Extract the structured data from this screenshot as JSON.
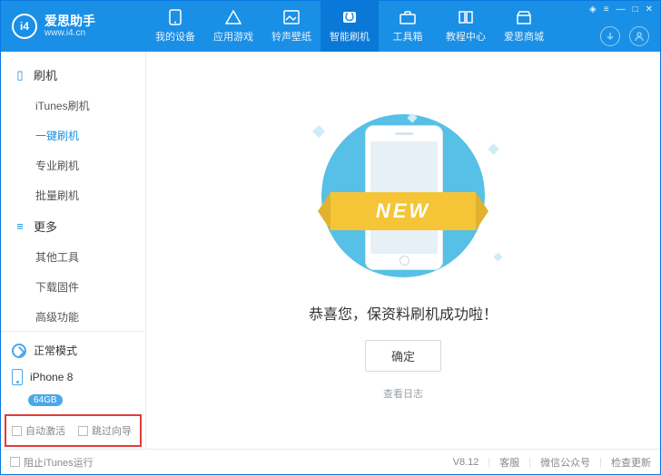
{
  "app": {
    "name": "爱思助手",
    "site": "www.i4.cn",
    "logo_text": "i4"
  },
  "header": {
    "tabs": [
      {
        "id": "device",
        "label": "我的设备"
      },
      {
        "id": "apps",
        "label": "应用游戏"
      },
      {
        "id": "ring",
        "label": "铃声壁纸"
      },
      {
        "id": "flash",
        "label": "智能刷机",
        "active": true
      },
      {
        "id": "tools",
        "label": "工具箱"
      },
      {
        "id": "tutorial",
        "label": "教程中心"
      },
      {
        "id": "store",
        "label": "爱思商城"
      }
    ]
  },
  "sidebar": {
    "group_flash": {
      "title": "刷机",
      "items": [
        {
          "id": "itunes",
          "label": "iTunes刷机"
        },
        {
          "id": "oneclick",
          "label": "一键刷机",
          "active": true
        },
        {
          "id": "pro",
          "label": "专业刷机"
        },
        {
          "id": "batch",
          "label": "批量刷机"
        }
      ]
    },
    "group_more": {
      "title": "更多",
      "items": [
        {
          "id": "other",
          "label": "其他工具"
        },
        {
          "id": "firmware",
          "label": "下载固件"
        },
        {
          "id": "adv",
          "label": "高级功能"
        }
      ]
    },
    "device": {
      "mode": "正常模式",
      "name": "iPhone 8",
      "storage": "64GB"
    },
    "checks": {
      "auto_activate": "自动激活",
      "skip_wizard": "跳过向导"
    }
  },
  "main": {
    "ribbon_text": "NEW",
    "success_message": "恭喜您，保资料刷机成功啦！",
    "ok_button": "确定",
    "view_log": "查看日志"
  },
  "footer": {
    "block_itunes": "阻止iTunes运行",
    "version": "V8.12",
    "support": "客服",
    "wechat": "微信公众号",
    "update": "检查更新"
  }
}
